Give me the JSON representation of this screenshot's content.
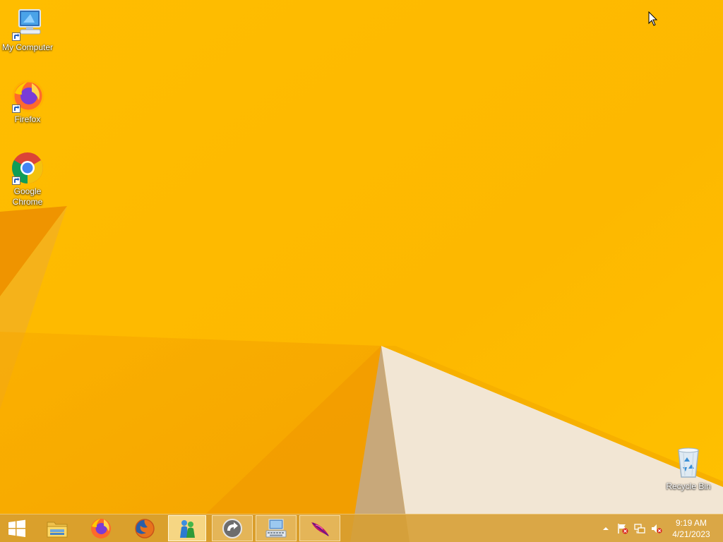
{
  "desktop": {
    "icons": [
      {
        "label": "My Computer",
        "icon": "computer-icon"
      },
      {
        "label": "Firefox",
        "icon": "firefox-icon"
      },
      {
        "label": "Google Chrome",
        "icon": "chrome-icon"
      },
      {
        "label": "Recycle Bin",
        "icon": "recycle-bin-icon"
      }
    ]
  },
  "taskbar": {
    "start": {
      "icon": "windows-logo-icon"
    },
    "pinned": [
      {
        "icon": "file-explorer-icon",
        "state": "idle"
      },
      {
        "icon": "firefox-icon",
        "state": "idle"
      },
      {
        "icon": "firefox-legacy-icon",
        "state": "idle"
      },
      {
        "icon": "messenger-people-icon",
        "state": "active"
      },
      {
        "icon": "circular-arrow-icon",
        "state": "running"
      },
      {
        "icon": "keyboard-computer-icon",
        "state": "running"
      },
      {
        "icon": "feather-icon",
        "state": "running"
      }
    ],
    "tray": {
      "icons": [
        "show-hidden-icons-chevron-icon",
        "action-center-flag-icon",
        "network-icon",
        "volume-muted-icon"
      ],
      "time": "9:19 AM",
      "date": "4/21/2023"
    }
  },
  "colors": {
    "wallpaper": "#f9b800",
    "wallpaper_deep": "#f39a00",
    "taskbar": "#d69e32"
  }
}
